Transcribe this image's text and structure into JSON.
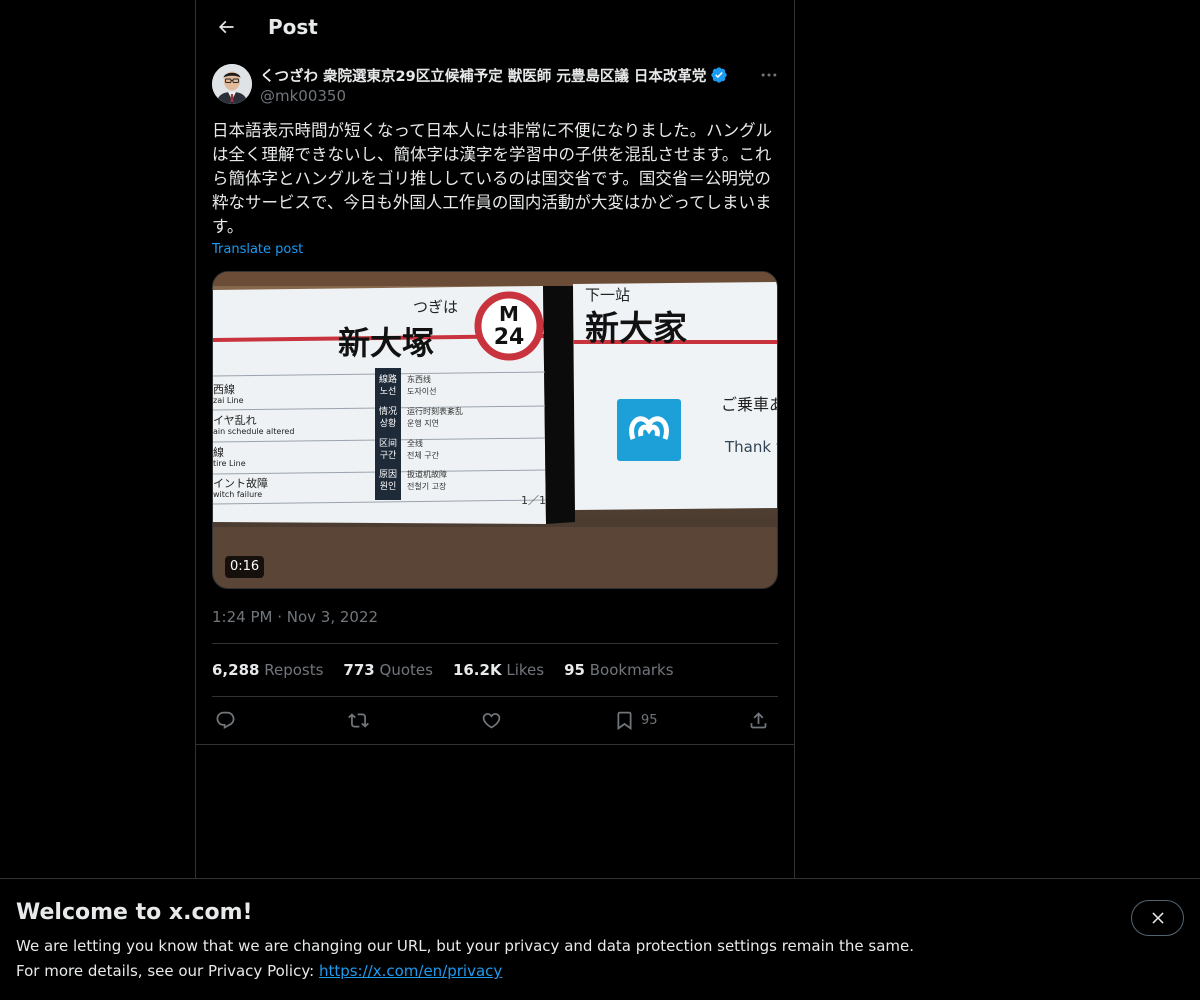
{
  "header": {
    "title": "Post"
  },
  "author": {
    "name": "くつざわ 衆院選東京29区立候補予定 獣医師 元豊島区議 日本改革党",
    "handle": "@mk00350",
    "verified": true
  },
  "post": {
    "text": "日本語表示時間が短くなって日本人には非常に不便になりました。ハングルは全く理解できないし、簡体字は漢字を学習中の子供を混乱させます。これら簡体字とハングルをゴリ推ししているのは国交省です。国交省＝公明党の粋なサービスで、今日も外国人工作員の国内活動が大変はかどってしまいます。",
    "translate_label": "Translate post",
    "timestamp": "1:24 PM · Nov 3, 2022"
  },
  "media": {
    "duration": "0:16",
    "sign": {
      "next_label": "つぎは",
      "station_name": "新大塚",
      "line_letter": "M",
      "station_number": "24",
      "zh_next_label": "下一站",
      "zh_station_name": "新大家",
      "ja_greeting": "ご乗車あ",
      "en_greeting": "Thank y",
      "page_indicator": "1／1",
      "left_lines": [
        "西線",
        "zai Line",
        "イヤ乱れ",
        "ain schedule altered",
        "線",
        "tire Line",
        "イント故障",
        "witch failure"
      ],
      "rows": [
        {
          "label": "線路",
          "label_ko": "노선",
          "value": "东西线",
          "value_ko": "도자이선"
        },
        {
          "label": "情况",
          "label_ko": "상황",
          "value": "运行时刻表紊乱",
          "value_ko": "운행 지연"
        },
        {
          "label": "区间",
          "label_ko": "구간",
          "value": "全线",
          "value_ko": "전체 구간"
        },
        {
          "label": "原因",
          "label_ko": "원인",
          "value": "扳道机故障",
          "value_ko": "전철기 고장"
        }
      ]
    }
  },
  "stats": {
    "reposts_count": "6,288",
    "reposts_label": "Reposts",
    "quotes_count": "773",
    "quotes_label": "Quotes",
    "likes_count": "16.2K",
    "likes_label": "Likes",
    "bookmarks_count": "95",
    "bookmarks_label": "Bookmarks"
  },
  "actions": {
    "reply_icon": "reply-icon",
    "repost_icon": "repost-icon",
    "like_icon": "heart-icon",
    "bookmark_icon": "bookmark-icon",
    "bookmark_count": "95",
    "share_icon": "share-icon"
  },
  "banner": {
    "title": "Welcome to x.com!",
    "line1": "We are letting you know that we are changing our URL, but your privacy and data protection settings remain the same.",
    "line2_prefix": "For more details, see our Privacy Policy: ",
    "link": "https://x.com/en/privacy"
  },
  "colors": {
    "accent": "#1d9bf0",
    "muted": "#71767b",
    "border": "#2f3336",
    "background": "#000000"
  }
}
